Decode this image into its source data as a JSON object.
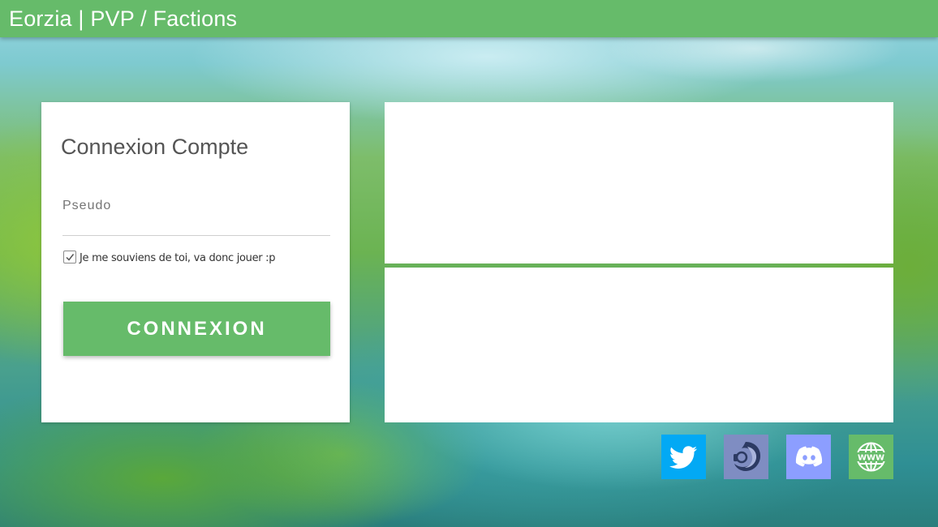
{
  "header": {
    "title": "Eorzia | PVP / Factions"
  },
  "login": {
    "title": "Connexion Compte",
    "pseudo_label": "Pseudo",
    "pseudo_value": "",
    "remember_label": "Je me souviens de toi, va donc jouer :p",
    "remember_checked": true,
    "submit_label": "CONNEXION"
  },
  "social": [
    {
      "name": "Twitter",
      "icon": "twitter-icon",
      "color": "#03a9f4"
    },
    {
      "name": "TeamSpeak",
      "icon": "teamspeak-icon",
      "color": "#7f8dc2"
    },
    {
      "name": "Discord",
      "icon": "discord-icon",
      "color": "#8c9eff"
    },
    {
      "name": "Site web",
      "icon": "globe-www-icon",
      "color": "#66bb6a"
    }
  ],
  "colors": {
    "accent": "#66bb6a",
    "card": "#ffffff"
  }
}
